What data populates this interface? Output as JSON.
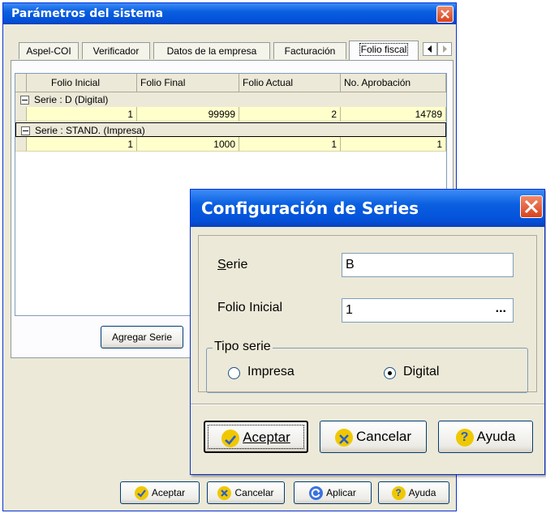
{
  "main_window": {
    "title": "Parámetros del sistema",
    "tabs": [
      {
        "label": "Aspel-COI"
      },
      {
        "label": "Verificador"
      },
      {
        "label": "Datos de la empresa"
      },
      {
        "label": "Facturación"
      },
      {
        "label": "Folio fiscal",
        "active": true
      }
    ],
    "grid": {
      "columns": [
        "Folio Inicial",
        "Folio Final",
        "Folio Actual",
        "No. Aprobación"
      ],
      "groups": [
        {
          "label": "Serie : D (Digital)",
          "rows": [
            [
              "1",
              "99999",
              "2",
              "14789"
            ]
          ]
        },
        {
          "label": "Serie : STAND. (Impresa)",
          "rows": [
            [
              "1",
              "1000",
              "1",
              "1"
            ]
          ]
        }
      ]
    },
    "add_series_button": "Agregar Serie",
    "buttons": {
      "accept": "Aceptar",
      "cancel": "Cancelar",
      "apply": "Aplicar",
      "help": "Ayuda"
    }
  },
  "dialog": {
    "title": "Configuración de Series",
    "serie_label": "Serie",
    "serie_value": "B",
    "folio_label": "Folio Inicial",
    "folio_value": "1",
    "ellipsis": "...",
    "tipo_legend": "Tipo serie",
    "radio_impresa": "Impresa",
    "radio_digital": "Digital",
    "selected_type": "Digital",
    "buttons": {
      "accept": "Aceptar",
      "cancel": "Cancelar",
      "help": "Ayuda"
    }
  },
  "colors": {
    "titlebar": "#0a5fe0",
    "close": "#d8421c",
    "grid_row": "#ffffcc",
    "window_bg": "#ece9d8"
  }
}
